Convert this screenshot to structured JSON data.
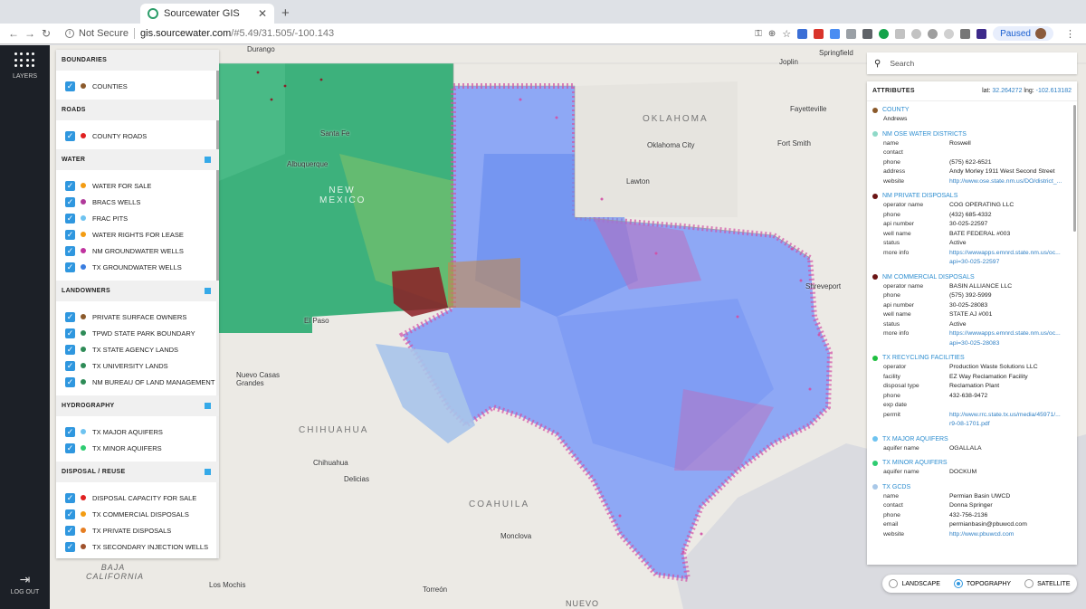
{
  "browser": {
    "tab_title": "Sourcewater GIS",
    "new_tab": "+",
    "security": "Not Secure",
    "url_host": "gis.sourcewater.com",
    "url_path": "/#5.49/31.505/-100.143",
    "profile_status": "Paused"
  },
  "leftnav": {
    "layers_label": "LAYERS",
    "logout_label": "LOG OUT"
  },
  "map_labels": {
    "oklahoma": "OKLAHOMA",
    "new_mexico": "NEW MEXICO",
    "chihuahua": "CHIHUAHUA",
    "coahuila": "COAHUILA",
    "baja_california": "BAJA CALIFORNIA",
    "nuevo": "NUEVO",
    "durango": "Durango",
    "springfield": "Springfield",
    "joplin": "Joplin",
    "fayetteville": "Fayetteville",
    "fort_smith": "Fort Smith",
    "oklahoma_city": "Oklahoma City",
    "lawton": "Lawton",
    "santa_fe": "Santa Fe",
    "albuquerque": "Albuquerque",
    "el_paso": "El Paso",
    "nuevo_casas_grandes": "Nuevo Casas Grandes",
    "chihuahua_city": "Chihuahua",
    "delicias": "Delicias",
    "monclova": "Monclova",
    "torreon": "Torreón",
    "los_mochis": "Los Mochis",
    "shreveport": "Shreveport"
  },
  "layers": {
    "sections": [
      {
        "title": "BOUNDARIES",
        "toggle": false,
        "items": [
          {
            "label": "COUNTIES",
            "color": "#8b5a2b"
          }
        ]
      },
      {
        "title": "ROADS",
        "toggle": false,
        "items": [
          {
            "label": "COUNTY ROADS",
            "color": "#e02020"
          }
        ]
      },
      {
        "title": "WATER",
        "toggle": true,
        "items": [
          {
            "label": "WATER FOR SALE",
            "color": "#f39c12"
          },
          {
            "label": "BRACS WELLS",
            "color": "#b03a9a"
          },
          {
            "label": "FRAC PITS",
            "color": "#6ec3f0"
          },
          {
            "label": "WATER RIGHTS FOR LEASE",
            "color": "#f39c12"
          },
          {
            "label": "NM GROUNDWATER WELLS",
            "color": "#c0339f"
          },
          {
            "label": "TX GROUNDWATER WELLS",
            "color": "#3a7de0"
          }
        ]
      },
      {
        "title": "LANDOWNERS",
        "toggle": true,
        "items": [
          {
            "label": "PRIVATE SURFACE OWNERS",
            "color": "#8b5a2b"
          },
          {
            "label": "TPWD STATE PARK BOUNDARY",
            "color": "#2e8b57"
          },
          {
            "label": "TX STATE AGENCY LANDS",
            "color": "#2e8b57"
          },
          {
            "label": "TX UNIVERSITY LANDS",
            "color": "#2e8b57"
          },
          {
            "label": "NM BUREAU OF LAND MANAGEMENT",
            "color": "#2e8b57"
          }
        ]
      },
      {
        "title": "HYDROGRAPHY",
        "toggle": true,
        "items": [
          {
            "label": "TX MAJOR AQUIFERS",
            "color": "#6ec3f0"
          },
          {
            "label": "TX MINOR AQUIFERS",
            "color": "#2ecc71"
          }
        ]
      },
      {
        "title": "DISPOSAL / REUSE",
        "toggle": true,
        "items": [
          {
            "label": "DISPOSAL CAPACITY FOR SALE",
            "color": "#e02020"
          },
          {
            "label": "TX COMMERCIAL DISPOSALS",
            "color": "#f39c12"
          },
          {
            "label": "TX PRIVATE DISPOSALS",
            "color": "#e67e22"
          },
          {
            "label": "TX SECONDARY INJECTION WELLS",
            "color": "#a0522d"
          }
        ]
      }
    ]
  },
  "search": {
    "placeholder": "Search"
  },
  "attributes": {
    "title": "ATTRIBUTES",
    "lat_label": "lat:",
    "lat": "32.264272",
    "lng_label": "lng:",
    "lng": "-102.613182",
    "groups": [
      {
        "title": "COUNTY",
        "color": "#8b5a2b",
        "rows": [
          {
            "k": "",
            "v": "Andrews",
            "link": false
          }
        ]
      },
      {
        "title": "NM OSE WATER DISTRICTS",
        "color": "#8fd9c8",
        "rows": [
          {
            "k": "name",
            "v": "Roswell",
            "link": false
          },
          {
            "k": "contact",
            "v": "",
            "link": false
          },
          {
            "k": "phone",
            "v": "(575) 622-6521",
            "link": false
          },
          {
            "k": "address",
            "v": "Andy Morley 1911 West Second Street",
            "link": false
          },
          {
            "k": "website",
            "v": "http://www.ose.state.nm.us/DO/district_...",
            "link": true
          }
        ]
      },
      {
        "title": "NM PRIVATE DISPOSALS",
        "color": "#6b1414",
        "rows": [
          {
            "k": "operator name",
            "v": "COG OPERATING LLC",
            "link": false
          },
          {
            "k": "phone",
            "v": "(432) 685-4332",
            "link": false
          },
          {
            "k": "api number",
            "v": "30-025-22597",
            "link": false
          },
          {
            "k": "well name",
            "v": "BATE FEDERAL #003",
            "link": false
          },
          {
            "k": "status",
            "v": "Active",
            "link": false
          },
          {
            "k": "more info",
            "v": "https://wwwapps.emnrd.state.nm.us/oc...",
            "link": true
          },
          {
            "k": "",
            "v": "api=30-025-22597",
            "link": true
          }
        ]
      },
      {
        "title": "NM COMMERCIAL DISPOSALS",
        "color": "#6b1414",
        "rows": [
          {
            "k": "operator name",
            "v": "BASIN ALLIANCE LLC",
            "link": false
          },
          {
            "k": "phone",
            "v": "(575) 392-5999",
            "link": false
          },
          {
            "k": "api number",
            "v": "30-025-28083",
            "link": false
          },
          {
            "k": "well name",
            "v": "STATE AJ #001",
            "link": false
          },
          {
            "k": "status",
            "v": "Active",
            "link": false
          },
          {
            "k": "more info",
            "v": "https://wwwapps.emnrd.state.nm.us/oc...",
            "link": true
          },
          {
            "k": "",
            "v": "api=30-025-28083",
            "link": true
          }
        ]
      },
      {
        "title": "TX RECYCLING FACILITIES",
        "color": "#1fbf3f",
        "rows": [
          {
            "k": "operator",
            "v": "Production Waste Solutions LLC",
            "link": false
          },
          {
            "k": "facility",
            "v": "EZ Way Reclamation Facility",
            "link": false
          },
          {
            "k": "disposal type",
            "v": "Reclamation Plant",
            "link": false
          },
          {
            "k": "phone",
            "v": "432-638-9472",
            "link": false
          },
          {
            "k": "exp date",
            "v": "",
            "link": false
          },
          {
            "k": "permit",
            "v": "http://www.rrc.state.tx.us/media/45971/...",
            "link": true
          },
          {
            "k": "",
            "v": "r9-08-1701.pdf",
            "link": true
          }
        ]
      },
      {
        "title": "TX MAJOR AQUIFERS",
        "color": "#6ec3f0",
        "rows": [
          {
            "k": "aquifer name",
            "v": "OGALLALA",
            "link": false
          }
        ]
      },
      {
        "title": "TX MINOR AQUIFERS",
        "color": "#2ecc71",
        "rows": [
          {
            "k": "aquifer name",
            "v": "DOCKUM",
            "link": false
          }
        ]
      },
      {
        "title": "TX GCDS",
        "color": "#a9c8e8",
        "rows": [
          {
            "k": "name",
            "v": "Permian Basin UWCD",
            "link": false
          },
          {
            "k": "contact",
            "v": "Donna Springer",
            "link": false
          },
          {
            "k": "phone",
            "v": "432-756-2136",
            "link": false
          },
          {
            "k": "email",
            "v": "permianbasin@pbuwcd.com",
            "link": false
          },
          {
            "k": "website",
            "v": "http://www.pbuwcd.com",
            "link": true
          }
        ]
      }
    ]
  },
  "basemap": {
    "options": [
      "LANDSCAPE",
      "TOPOGRAPHY",
      "SATELLITE"
    ],
    "selected": "TOPOGRAPHY"
  }
}
